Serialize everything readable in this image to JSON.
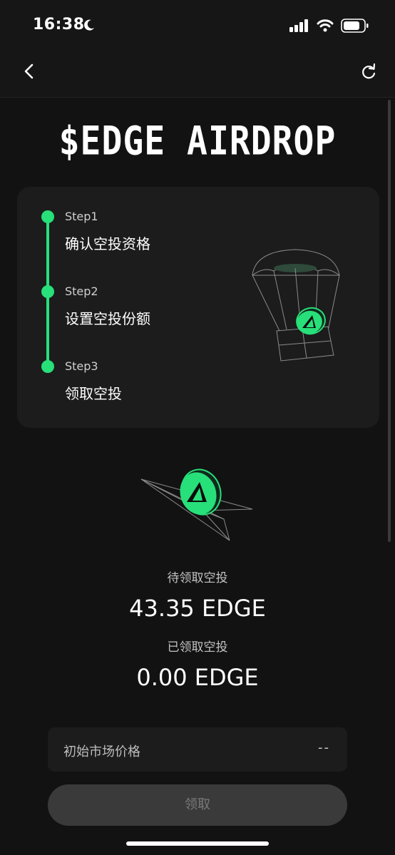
{
  "status_bar": {
    "time": "16:38",
    "icons": [
      "moon-icon",
      "cellular-signal-icon",
      "wifi-icon",
      "battery-icon"
    ]
  },
  "nav": {
    "back_icon": "chevron-left-icon",
    "refresh_icon": "refresh-icon"
  },
  "page": {
    "title": "$EDGE AIRDROP"
  },
  "steps": [
    {
      "step": "Step1",
      "label": "确认空投资格"
    },
    {
      "step": "Step2",
      "label": "设置空投份额"
    },
    {
      "step": "Step3",
      "label": "领取空投"
    }
  ],
  "airdrop": {
    "pending_label": "待领取空投",
    "pending_amount": "43.35 EDGE",
    "claimed_label": "已领取空投",
    "claimed_amount": "0.00 EDGE"
  },
  "price": {
    "label": "初始市场价格",
    "value": "--"
  },
  "claim_button": {
    "label": "领取"
  },
  "colors": {
    "accent": "#27e07a",
    "background": "#121212",
    "card": "#1c1c1c",
    "button_disabled": "#3a3a3a"
  }
}
